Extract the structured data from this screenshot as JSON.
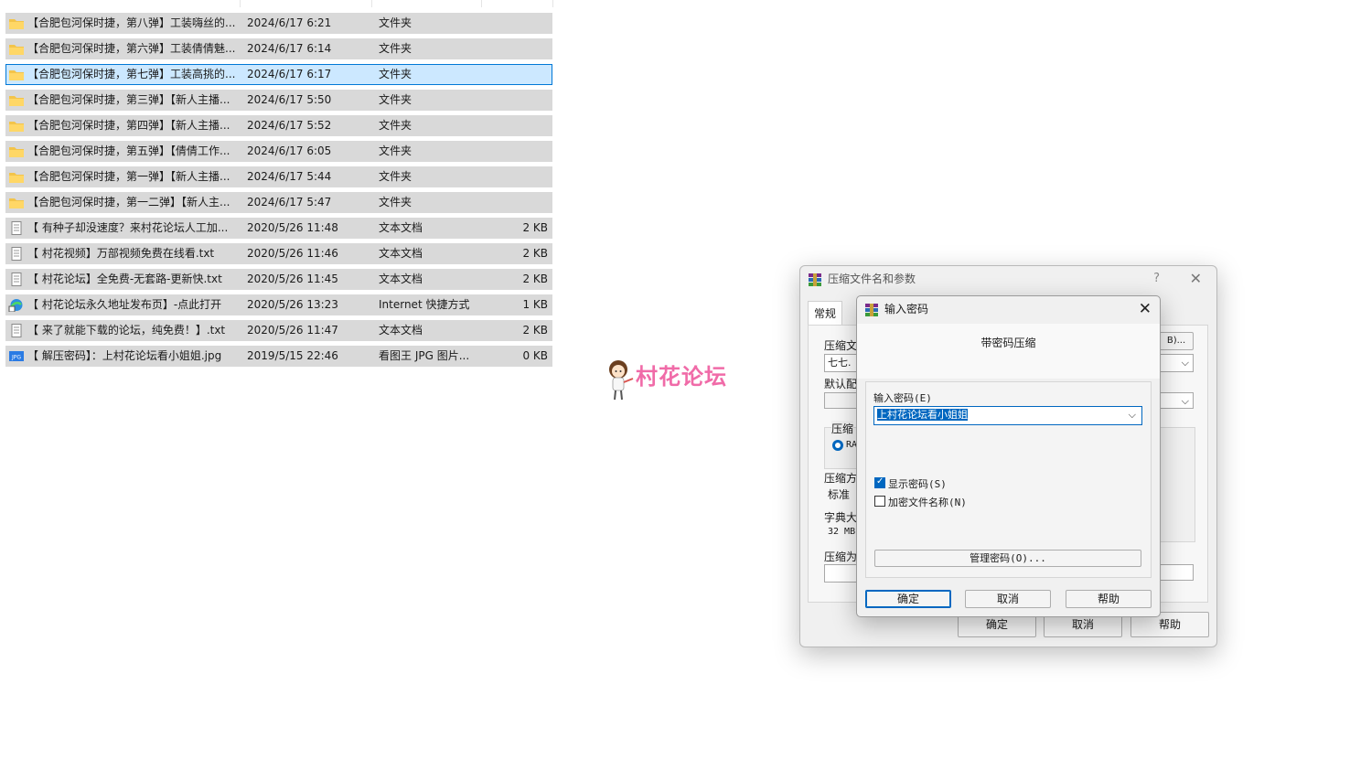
{
  "files": [
    {
      "name": "【合肥包河保时捷，第八弹】工装嗨丝的...",
      "date": "2024/6/17 6:21",
      "type": "文件夹",
      "size": "",
      "icon": "folder-icon",
      "selected": false
    },
    {
      "name": "【合肥包河保时捷，第六弹】工装倩倩魅...",
      "date": "2024/6/17 6:14",
      "type": "文件夹",
      "size": "",
      "icon": "folder-icon",
      "selected": false
    },
    {
      "name": "【合肥包河保时捷，第七弹】工装高挑的...",
      "date": "2024/6/17 6:17",
      "type": "文件夹",
      "size": "",
      "icon": "folder-icon",
      "selected": true
    },
    {
      "name": "【合肥包河保时捷，第三弹】【新人主播...",
      "date": "2024/6/17 5:50",
      "type": "文件夹",
      "size": "",
      "icon": "folder-icon",
      "selected": false
    },
    {
      "name": "【合肥包河保时捷，第四弹】【新人主播...",
      "date": "2024/6/17 5:52",
      "type": "文件夹",
      "size": "",
      "icon": "folder-icon",
      "selected": false
    },
    {
      "name": "【合肥包河保时捷，第五弹】【倩倩工作...",
      "date": "2024/6/17 6:05",
      "type": "文件夹",
      "size": "",
      "icon": "folder-icon",
      "selected": false
    },
    {
      "name": "【合肥包河保时捷，第一弹】【新人主播...",
      "date": "2024/6/17 5:44",
      "type": "文件夹",
      "size": "",
      "icon": "folder-icon",
      "selected": false
    },
    {
      "name": "【合肥包河保时捷，第一二弹】【新人主...",
      "date": "2024/6/17 5:47",
      "type": "文件夹",
      "size": "",
      "icon": "folder-icon",
      "selected": false
    },
    {
      "name": "【 有种子却没速度？来村花论坛人工加...",
      "date": "2020/5/26 11:48",
      "type": "文本文档",
      "size": "2 KB",
      "icon": "text-file-icon",
      "selected": false
    },
    {
      "name": "【 村花视频】万部视频免费在线看.txt",
      "date": "2020/5/26 11:46",
      "type": "文本文档",
      "size": "2 KB",
      "icon": "text-file-icon",
      "selected": false
    },
    {
      "name": "【 村花论坛】全免费-无套路-更新快.txt",
      "date": "2020/5/26 11:45",
      "type": "文本文档",
      "size": "2 KB",
      "icon": "text-file-icon",
      "selected": false
    },
    {
      "name": "【 村花论坛永久地址发布页】-点此打开",
      "date": "2020/5/26 13:23",
      "type": "Internet 快捷方式",
      "size": "1 KB",
      "icon": "internet-shortcut-icon",
      "selected": false
    },
    {
      "name": "【 来了就能下载的论坛，纯免费！】.txt",
      "date": "2020/5/26 11:47",
      "type": "文本文档",
      "size": "2 KB",
      "icon": "text-file-icon",
      "selected": false
    },
    {
      "name": "【 解压密码】：上村花论坛看小姐姐.jpg",
      "date": "2019/5/15 22:46",
      "type": "看图王 JPG 图片...",
      "size": "0 KB",
      "icon": "jpg-image-icon",
      "selected": false
    }
  ],
  "watermark": {
    "text": "村花论坛"
  },
  "archive_dialog": {
    "title": "压缩文件名和参数",
    "help": "?",
    "close": "✕",
    "tab_general": "常规",
    "archive_name_label": "压缩文",
    "archive_name_value": "七七.",
    "browse_label": "B)...",
    "default_profile_label": "默认配",
    "format_group_label": "压缩",
    "format_rar": "RA",
    "method_label": "压缩方",
    "method_value": "标准",
    "dict_label": "字典大",
    "dict_value": "32 MB",
    "split_label": "压缩为",
    "ok": "确定",
    "cancel": "取消",
    "help_btn": "帮助"
  },
  "password_dialog": {
    "title": "输入密码",
    "close": "✕",
    "heading": "带密码压缩",
    "password_label": "输入密码(E)",
    "password_value": "上村花论坛看小姐姐",
    "show_password": "显示密码(S)",
    "show_password_checked": true,
    "encrypt_names": "加密文件名称(N)",
    "encrypt_names_checked": false,
    "manage": "管理密码(O)...",
    "ok": "确定",
    "cancel": "取消",
    "help": "帮助"
  }
}
